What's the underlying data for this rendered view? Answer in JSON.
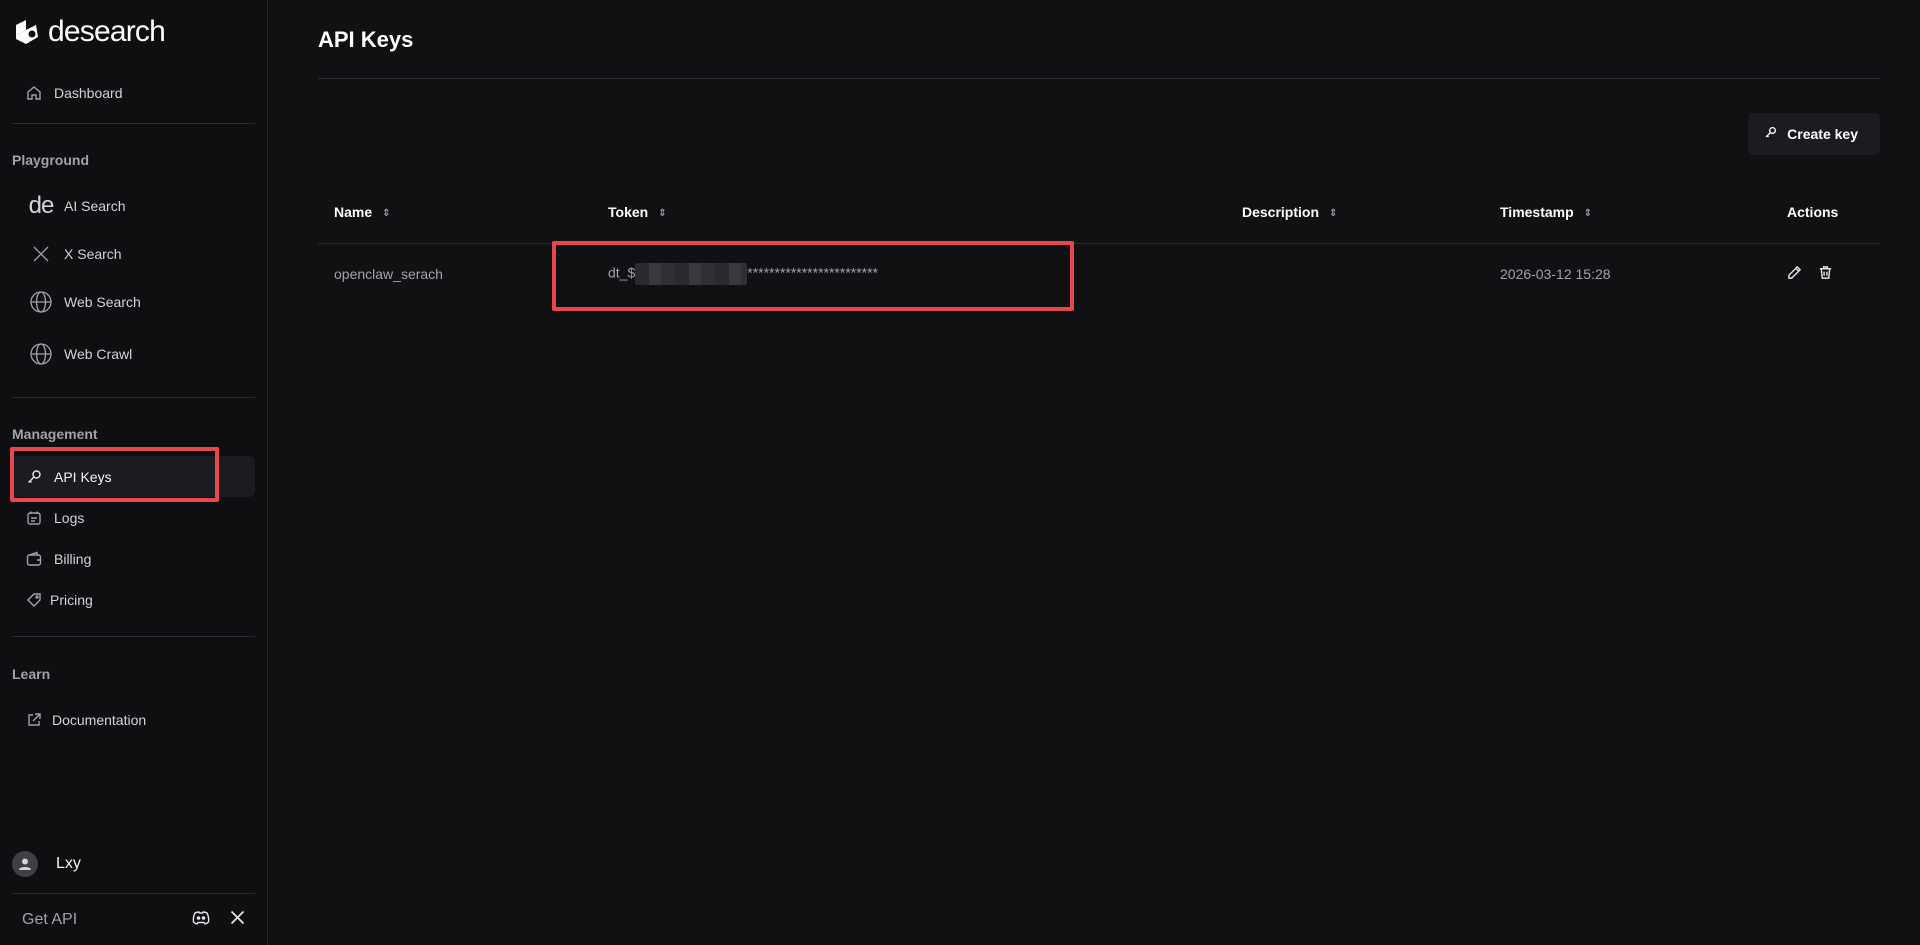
{
  "brand": {
    "name": "desearch"
  },
  "sidebar": {
    "dashboard": "Dashboard",
    "playground": {
      "title": "Playground",
      "items": [
        {
          "label": "AI Search",
          "icon": "de-logo-icon"
        },
        {
          "label": "X Search",
          "icon": "x-icon"
        },
        {
          "label": "Web Search",
          "icon": "globe-icon"
        },
        {
          "label": "Web Crawl",
          "icon": "globe-icon"
        }
      ]
    },
    "management": {
      "title": "Management",
      "items": [
        {
          "label": "API Keys",
          "icon": "key-icon",
          "active": true
        },
        {
          "label": "Logs",
          "icon": "calendar-icon"
        },
        {
          "label": "Billing",
          "icon": "wallet-icon"
        },
        {
          "label": "Pricing",
          "icon": "tag-icon"
        }
      ]
    },
    "learn": {
      "title": "Learn",
      "items": [
        {
          "label": "Documentation",
          "icon": "external-link-icon"
        }
      ]
    },
    "user": {
      "name": "Lxy"
    },
    "footer": {
      "get_api": "Get API"
    }
  },
  "main": {
    "title": "API Keys",
    "create_button": "Create key",
    "table": {
      "columns": [
        "Name",
        "Token",
        "Description",
        "Timestamp",
        "Actions"
      ],
      "rows": [
        {
          "name": "openclaw_serach",
          "token_prefix": "dt_$",
          "token_mask": "************************",
          "description": "",
          "timestamp": "2026-03-12 15:28"
        }
      ]
    }
  },
  "colors": {
    "highlight": "#e5484d",
    "background": "#111114",
    "active_bg": "#1c1c20"
  }
}
